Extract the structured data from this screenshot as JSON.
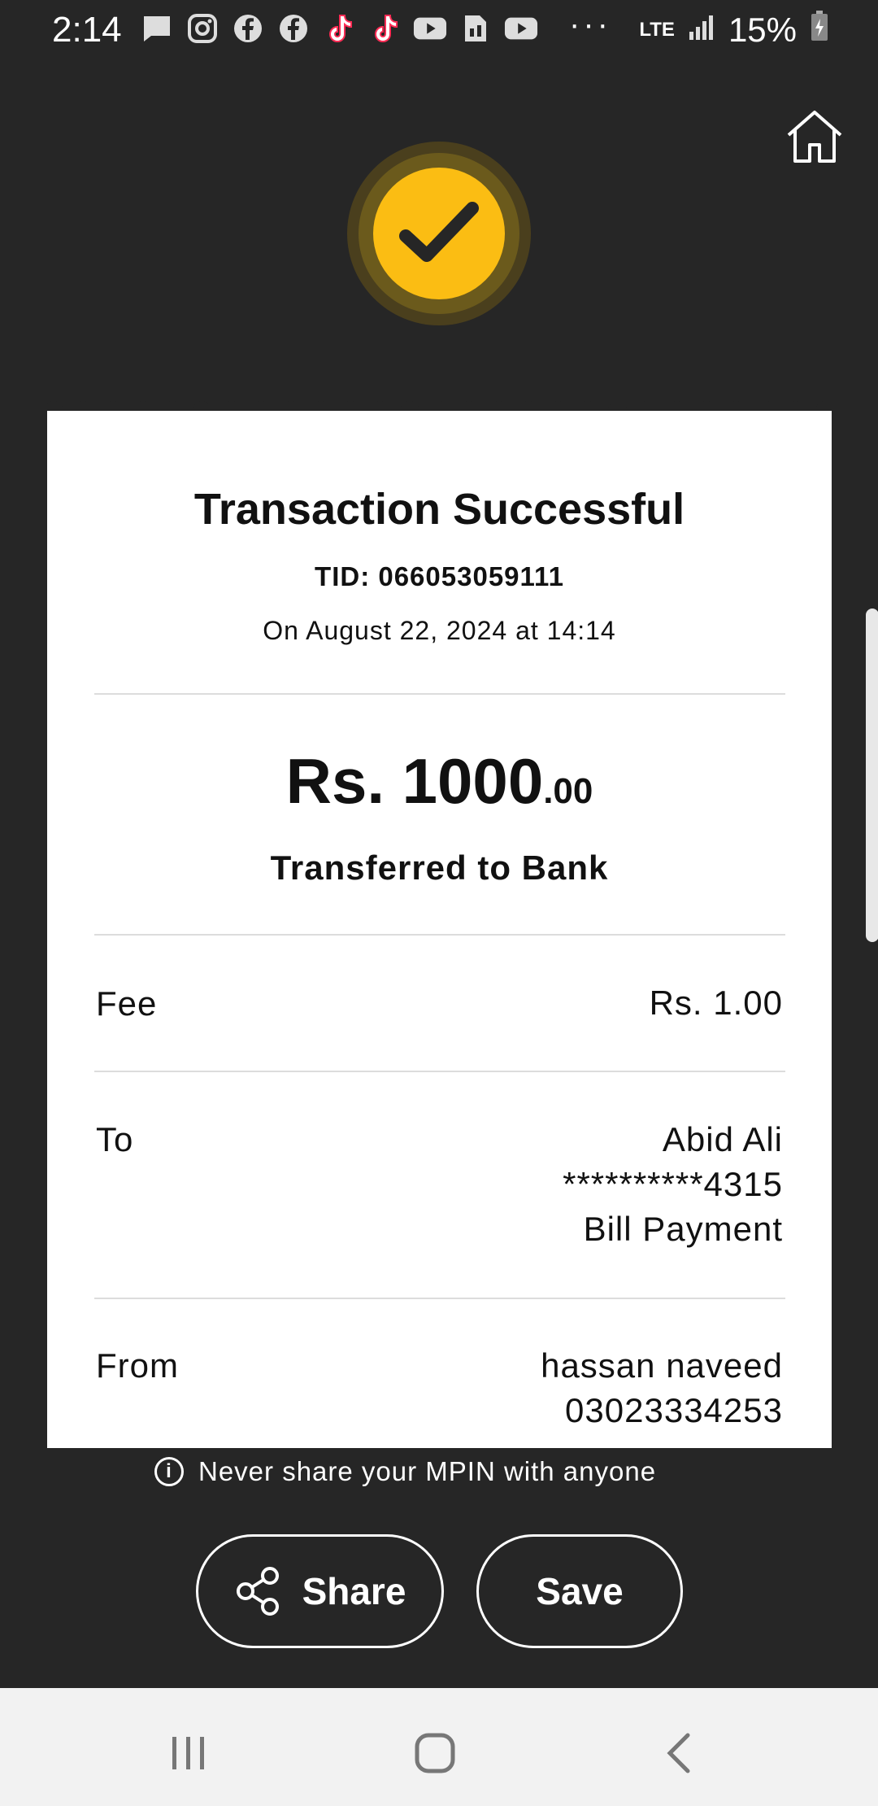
{
  "status_bar": {
    "time": "2:14",
    "network": "LTE",
    "battery": "15%",
    "icons": [
      "message-icon",
      "instagram-icon",
      "facebook-icon",
      "facebook-icon",
      "tiktok-icon",
      "tiktok-icon",
      "youtube-icon",
      "sim-icon",
      "youtube-icon"
    ]
  },
  "receipt": {
    "title": "Transaction Successful",
    "tid": "TID: 066053059111",
    "date": "On August 22, 2024 at 14:14",
    "amount_main": "Rs. 1000",
    "amount_cents": ".00",
    "transfer_label": "Transferred to Bank",
    "fee_label": "Fee",
    "fee_value": "Rs. 1.00",
    "to_label": "To",
    "to_name": "Abid Ali",
    "to_account": "**********4315",
    "to_purpose": "Bill Payment",
    "from_label": "From",
    "from_name": "hassan naveed",
    "from_number": "03023334253"
  },
  "warning_text": "Never share your MPIN with anyone",
  "actions": {
    "share_label": "Share",
    "save_label": "Save"
  },
  "colors": {
    "background": "#262626",
    "accent": "#fbbd13",
    "receipt": "#ffffff"
  }
}
